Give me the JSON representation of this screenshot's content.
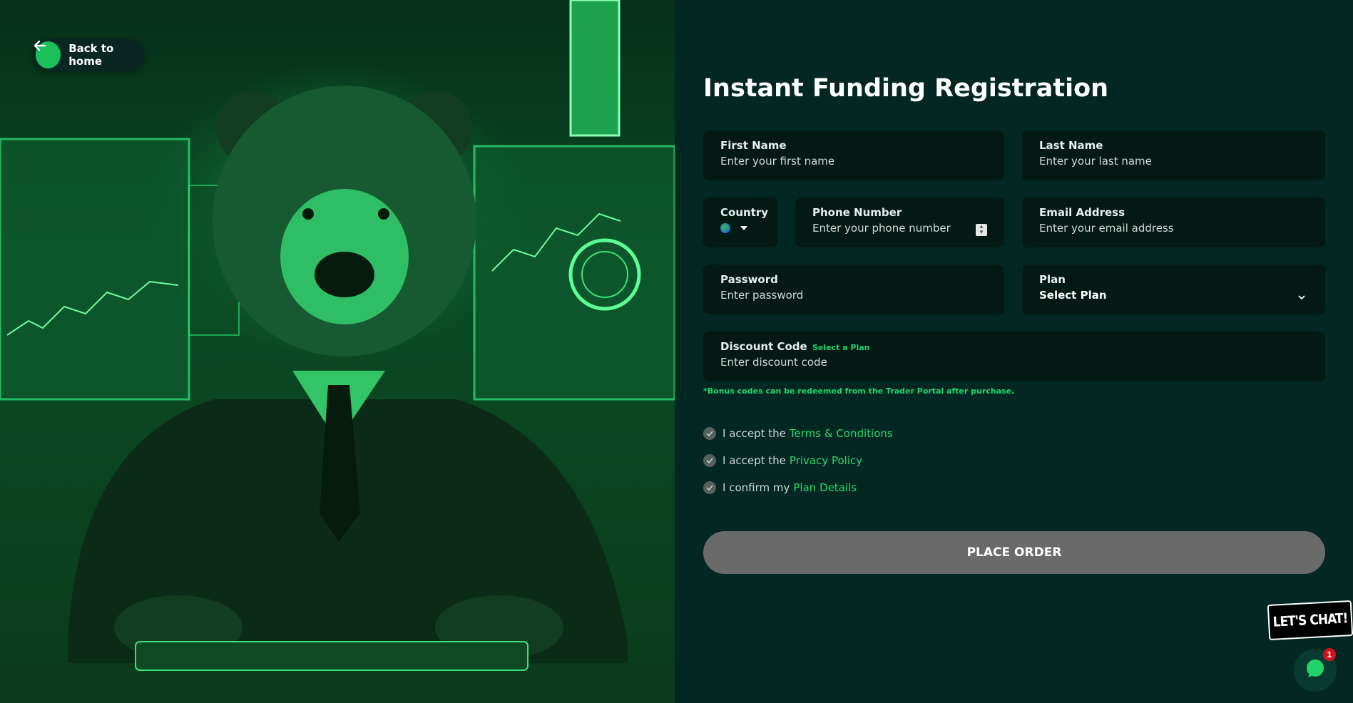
{
  "hero": {
    "back_label": "Back to home"
  },
  "form": {
    "title": "Instant Funding Registration",
    "first_name": {
      "label": "First Name",
      "placeholder": "Enter your first name"
    },
    "last_name": {
      "label": "Last Name",
      "placeholder": "Enter your last name"
    },
    "country": {
      "label": "Country"
    },
    "phone": {
      "label": "Phone Number",
      "placeholder": "Enter your phone number"
    },
    "email": {
      "label": "Email Address",
      "placeholder": "Enter your email address"
    },
    "password": {
      "label": "Password",
      "placeholder": "Enter password"
    },
    "plan": {
      "label": "Plan",
      "value": "Select Plan"
    },
    "discount": {
      "label": "Discount Code",
      "hint": "Select a Plan",
      "placeholder": "Enter discount code"
    },
    "note": "*Bonus codes can be redeemed from the Trader Portal after purchase.",
    "checks": [
      {
        "text": "I accept the",
        "link": "Terms & Conditions"
      },
      {
        "text": "I accept the ",
        "link": "Privacy Policy"
      },
      {
        "text": "I confirm my",
        "link": "Plan Details"
      }
    ],
    "submit_label": "PLACE ORDER"
  },
  "chat": {
    "bubble_label": "LET'S CHAT!",
    "badge_count": "1"
  },
  "colors": {
    "background": "#032823",
    "field": "#021914",
    "accent": "#22d36a",
    "button": "#6a6a6a"
  }
}
